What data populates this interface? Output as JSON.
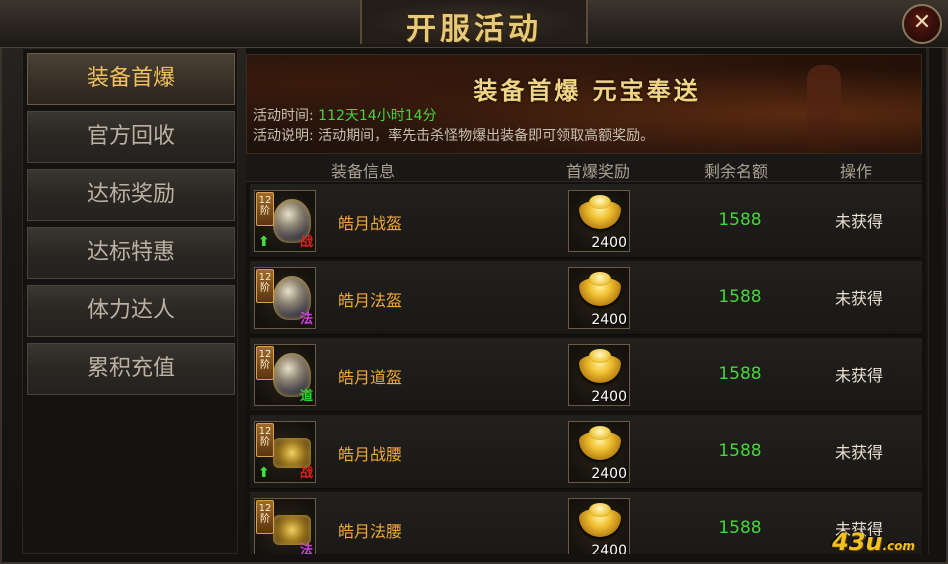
{
  "window": {
    "title": "开服活动",
    "close_icon": "✕"
  },
  "sidebar": {
    "items": [
      {
        "label": "装备首爆",
        "active": true
      },
      {
        "label": "官方回收",
        "active": false
      },
      {
        "label": "达标奖励",
        "active": false
      },
      {
        "label": "达标特惠",
        "active": false
      },
      {
        "label": "体力达人",
        "active": false
      },
      {
        "label": "累积充值",
        "active": false
      }
    ]
  },
  "banner": {
    "title": "装备首爆  元宝奉送",
    "time_label": "活动时间:",
    "time_value": "112天14小时14分",
    "desc_label": "活动说明:",
    "desc_value": "活动期间，率先击杀怪物爆出装备即可领取高额奖励。"
  },
  "table": {
    "headers": {
      "info": "装备信息",
      "reward": "首爆奖励",
      "remain": "剩余名额",
      "action": "操作"
    },
    "rows": [
      {
        "tier": "12阶",
        "name": "皓月战盔",
        "class": "战",
        "class_color": "#e02020",
        "up": true,
        "art": "helmet",
        "reward_qty": "2400",
        "remain": "1588",
        "status": "未获得"
      },
      {
        "tier": "12阶",
        "name": "皓月法盔",
        "class": "法",
        "class_color": "#d040e0",
        "up": false,
        "art": "helmet",
        "reward_qty": "2400",
        "remain": "1588",
        "status": "未获得"
      },
      {
        "tier": "12阶",
        "name": "皓月道盔",
        "class": "道",
        "class_color": "#30d030",
        "up": false,
        "art": "helmet",
        "reward_qty": "2400",
        "remain": "1588",
        "status": "未获得"
      },
      {
        "tier": "12阶",
        "name": "皓月战腰",
        "class": "战",
        "class_color": "#e02020",
        "up": true,
        "art": "belt",
        "reward_qty": "2400",
        "remain": "1588",
        "status": "未获得"
      },
      {
        "tier": "12阶",
        "name": "皓月法腰",
        "class": "法",
        "class_color": "#d040e0",
        "up": false,
        "art": "belt",
        "reward_qty": "2400",
        "remain": "1588",
        "status": "未获得"
      }
    ]
  },
  "watermark": {
    "main": "43u",
    "suffix": ".com"
  },
  "colors": {
    "accent_gold": "#f0c060",
    "value_green": "#46d63c",
    "item_orange": "#f0a838"
  }
}
